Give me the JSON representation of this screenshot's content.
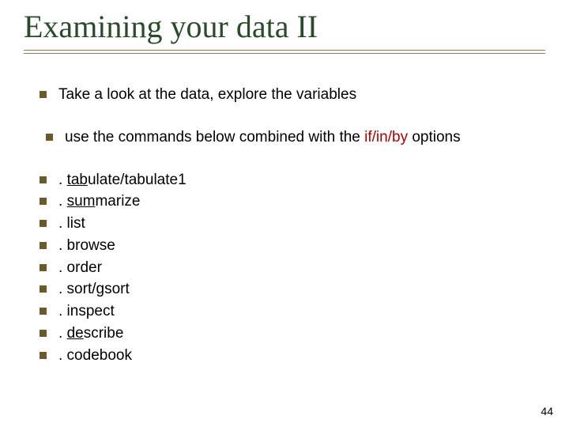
{
  "title": "Examining your data II",
  "bullets": {
    "b1": "Take a look at the data, explore the variables",
    "b2_pre": " use the commands below combined with the ",
    "b2_hl": "if/in/by",
    "b2_post": " options",
    "c1_pre": ". ",
    "c1_ul": "tab",
    "c1_post": "ulate/tabulate1",
    "c2_pre": ". ",
    "c2_ul": "sum",
    "c2_post": "marize",
    "c3": ". list",
    "c4": ". browse",
    "c5": ". order",
    "c6": ". sort/gsort",
    "c7": ". inspect",
    "c8_pre": ". ",
    "c8_ul": "de",
    "c8_post": "scribe",
    "c9": ". codebook"
  },
  "page_number": "44"
}
